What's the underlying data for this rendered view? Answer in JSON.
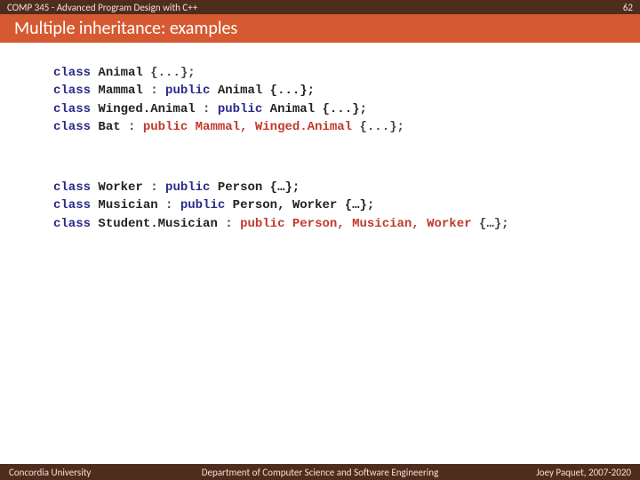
{
  "topbar": {
    "course": "COMP 345 - Advanced Program Design with C++",
    "page_number": "62"
  },
  "title": "Multiple inheritance: examples",
  "code": {
    "g1_l1_kw1": "class",
    "g1_l1_name": " Animal ",
    "g1_l1_rest": "{...};",
    "g1_l2_kw1": "class",
    "g1_l2_name": " Mammal ",
    "g1_l2_colon": ": ",
    "g1_l2_kw2": "public",
    "g1_l2_rest": " Animal {...};",
    "g1_l3_kw1": "class",
    "g1_l3_name": " Winged.Animal ",
    "g1_l3_colon": ": ",
    "g1_l3_kw2": "public",
    "g1_l3_rest": " Animal {...};",
    "g1_l4_kw1": "class",
    "g1_l4_name": " Bat ",
    "g1_l4_colon": ": ",
    "g1_l4_hl": "public Mammal, Winged.Animal",
    "g1_l4_rest": " {...};",
    "g2_l1_kw1": "class",
    "g2_l1_name": " Worker ",
    "g2_l1_colon": ": ",
    "g2_l1_kw2": "public",
    "g2_l1_rest": " Person {…};",
    "g2_l2_kw1": "class",
    "g2_l2_name": " Musician ",
    "g2_l2_colon": ": ",
    "g2_l2_kw2": "public",
    "g2_l2_rest": " Person, Worker {…};",
    "g2_l3_kw1": "class",
    "g2_l3_name": " Student.Musician ",
    "g2_l3_colon": ": ",
    "g2_l3_hl": "public Person, Musician, Worker",
    "g2_l3_rest": " {…};"
  },
  "footer": {
    "left": "Concordia University",
    "center": "Department of Computer Science and Software Engineering",
    "right": "Joey Paquet, 2007-2020"
  }
}
